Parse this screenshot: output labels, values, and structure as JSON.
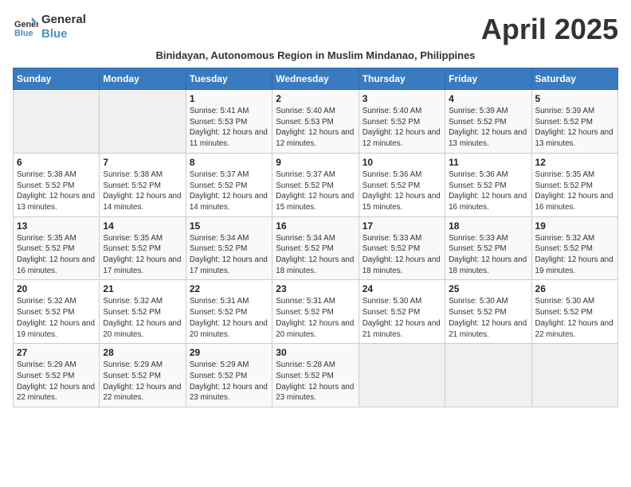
{
  "logo": {
    "line1": "General",
    "line2": "Blue"
  },
  "title": "April 2025",
  "subtitle": "Binidayan, Autonomous Region in Muslim Mindanao, Philippines",
  "headers": [
    "Sunday",
    "Monday",
    "Tuesday",
    "Wednesday",
    "Thursday",
    "Friday",
    "Saturday"
  ],
  "weeks": [
    [
      {
        "day": "",
        "info": ""
      },
      {
        "day": "",
        "info": ""
      },
      {
        "day": "1",
        "info": "Sunrise: 5:41 AM\nSunset: 5:53 PM\nDaylight: 12 hours and 11 minutes."
      },
      {
        "day": "2",
        "info": "Sunrise: 5:40 AM\nSunset: 5:53 PM\nDaylight: 12 hours and 12 minutes."
      },
      {
        "day": "3",
        "info": "Sunrise: 5:40 AM\nSunset: 5:52 PM\nDaylight: 12 hours and 12 minutes."
      },
      {
        "day": "4",
        "info": "Sunrise: 5:39 AM\nSunset: 5:52 PM\nDaylight: 12 hours and 13 minutes."
      },
      {
        "day": "5",
        "info": "Sunrise: 5:39 AM\nSunset: 5:52 PM\nDaylight: 12 hours and 13 minutes."
      }
    ],
    [
      {
        "day": "6",
        "info": "Sunrise: 5:38 AM\nSunset: 5:52 PM\nDaylight: 12 hours and 13 minutes."
      },
      {
        "day": "7",
        "info": "Sunrise: 5:38 AM\nSunset: 5:52 PM\nDaylight: 12 hours and 14 minutes."
      },
      {
        "day": "8",
        "info": "Sunrise: 5:37 AM\nSunset: 5:52 PM\nDaylight: 12 hours and 14 minutes."
      },
      {
        "day": "9",
        "info": "Sunrise: 5:37 AM\nSunset: 5:52 PM\nDaylight: 12 hours and 15 minutes."
      },
      {
        "day": "10",
        "info": "Sunrise: 5:36 AM\nSunset: 5:52 PM\nDaylight: 12 hours and 15 minutes."
      },
      {
        "day": "11",
        "info": "Sunrise: 5:36 AM\nSunset: 5:52 PM\nDaylight: 12 hours and 16 minutes."
      },
      {
        "day": "12",
        "info": "Sunrise: 5:35 AM\nSunset: 5:52 PM\nDaylight: 12 hours and 16 minutes."
      }
    ],
    [
      {
        "day": "13",
        "info": "Sunrise: 5:35 AM\nSunset: 5:52 PM\nDaylight: 12 hours and 16 minutes."
      },
      {
        "day": "14",
        "info": "Sunrise: 5:35 AM\nSunset: 5:52 PM\nDaylight: 12 hours and 17 minutes."
      },
      {
        "day": "15",
        "info": "Sunrise: 5:34 AM\nSunset: 5:52 PM\nDaylight: 12 hours and 17 minutes."
      },
      {
        "day": "16",
        "info": "Sunrise: 5:34 AM\nSunset: 5:52 PM\nDaylight: 12 hours and 18 minutes."
      },
      {
        "day": "17",
        "info": "Sunrise: 5:33 AM\nSunset: 5:52 PM\nDaylight: 12 hours and 18 minutes."
      },
      {
        "day": "18",
        "info": "Sunrise: 5:33 AM\nSunset: 5:52 PM\nDaylight: 12 hours and 18 minutes."
      },
      {
        "day": "19",
        "info": "Sunrise: 5:32 AM\nSunset: 5:52 PM\nDaylight: 12 hours and 19 minutes."
      }
    ],
    [
      {
        "day": "20",
        "info": "Sunrise: 5:32 AM\nSunset: 5:52 PM\nDaylight: 12 hours and 19 minutes."
      },
      {
        "day": "21",
        "info": "Sunrise: 5:32 AM\nSunset: 5:52 PM\nDaylight: 12 hours and 20 minutes."
      },
      {
        "day": "22",
        "info": "Sunrise: 5:31 AM\nSunset: 5:52 PM\nDaylight: 12 hours and 20 minutes."
      },
      {
        "day": "23",
        "info": "Sunrise: 5:31 AM\nSunset: 5:52 PM\nDaylight: 12 hours and 20 minutes."
      },
      {
        "day": "24",
        "info": "Sunrise: 5:30 AM\nSunset: 5:52 PM\nDaylight: 12 hours and 21 minutes."
      },
      {
        "day": "25",
        "info": "Sunrise: 5:30 AM\nSunset: 5:52 PM\nDaylight: 12 hours and 21 minutes."
      },
      {
        "day": "26",
        "info": "Sunrise: 5:30 AM\nSunset: 5:52 PM\nDaylight: 12 hours and 22 minutes."
      }
    ],
    [
      {
        "day": "27",
        "info": "Sunrise: 5:29 AM\nSunset: 5:52 PM\nDaylight: 12 hours and 22 minutes."
      },
      {
        "day": "28",
        "info": "Sunrise: 5:29 AM\nSunset: 5:52 PM\nDaylight: 12 hours and 22 minutes."
      },
      {
        "day": "29",
        "info": "Sunrise: 5:29 AM\nSunset: 5:52 PM\nDaylight: 12 hours and 23 minutes."
      },
      {
        "day": "30",
        "info": "Sunrise: 5:28 AM\nSunset: 5:52 PM\nDaylight: 12 hours and 23 minutes."
      },
      {
        "day": "",
        "info": ""
      },
      {
        "day": "",
        "info": ""
      },
      {
        "day": "",
        "info": ""
      }
    ]
  ]
}
